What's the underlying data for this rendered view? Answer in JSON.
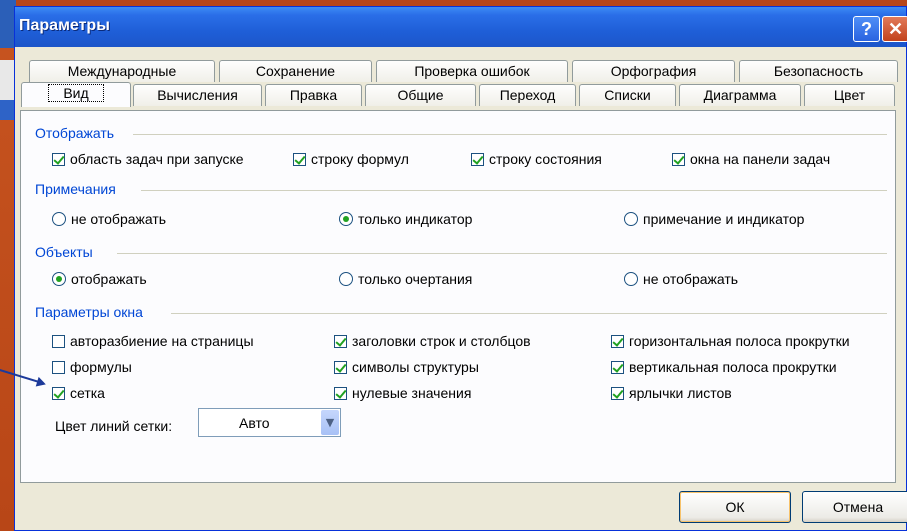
{
  "window": {
    "title": "Параметры",
    "help_glyph": "?",
    "close_glyph": "✕"
  },
  "tabs_row1": [
    "Международные",
    "Сохранение",
    "Проверка ошибок",
    "Орфография",
    "Безопасность"
  ],
  "tabs_row2": [
    "Вид",
    "Вычисления",
    "Правка",
    "Общие",
    "Переход",
    "Списки",
    "Диаграмма",
    "Цвет"
  ],
  "active_tab": "Вид",
  "groups": {
    "show": {
      "title": "Отображать",
      "items": [
        {
          "label": "область задач при запуске",
          "checked": true
        },
        {
          "label": "строку формул",
          "checked": true
        },
        {
          "label": "строку состояния",
          "checked": true
        },
        {
          "label": "окна на панели задач",
          "checked": true
        }
      ]
    },
    "comments": {
      "title": "Примечания",
      "items": [
        {
          "label": "не отображать",
          "selected": false
        },
        {
          "label": "только индикатор",
          "selected": true
        },
        {
          "label": "примечание и индикатор",
          "selected": false
        }
      ]
    },
    "objects": {
      "title": "Объекты",
      "items": [
        {
          "label": "отображать",
          "selected": true
        },
        {
          "label": "только очертания",
          "selected": false
        },
        {
          "label": "не отображать",
          "selected": false
        }
      ]
    },
    "window_options": {
      "title": "Параметры окна",
      "items": [
        {
          "label": "авторазбиение на страницы",
          "checked": false
        },
        {
          "label": "заголовки строк и столбцов",
          "checked": true
        },
        {
          "label": "горизонтальная полоса прокрутки",
          "checked": true
        },
        {
          "label": "формулы",
          "checked": false
        },
        {
          "label": "символы структуры",
          "checked": true
        },
        {
          "label": "вертикальная полоса прокрутки",
          "checked": true
        },
        {
          "label": "сетка",
          "checked": true
        },
        {
          "label": "нулевые значения",
          "checked": true
        },
        {
          "label": "ярлычки листов",
          "checked": true
        }
      ]
    }
  },
  "gridcolor": {
    "label": "Цвет линий сетки:",
    "value": "Авто"
  },
  "buttons": {
    "ok": "ОК",
    "cancel": "Отмена"
  },
  "colors": {
    "title_bar": "#1f5fd8",
    "group_title": "#0046d5",
    "check": "#21a121",
    "background": "#b6461a"
  }
}
